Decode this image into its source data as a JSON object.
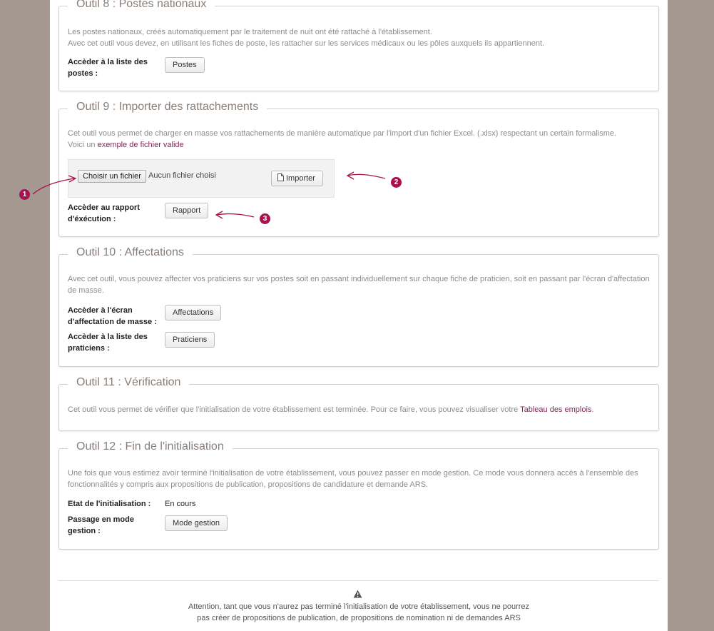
{
  "tool8": {
    "title": "Outil 8 : Postes nationaux",
    "desc1": "Les postes nationaux, créés automatiquement par le traitement de nuit ont été rattaché à l'établissement.",
    "desc2": "Avec cet outil vous devez, en utilisant les fiches de poste, les rattacher sur les services médicaux ou les pôles auxquels ils appartiennent.",
    "label": "Accèder à la liste des postes :",
    "button": "Postes"
  },
  "tool9": {
    "title": "Outil 9 : Importer des rattachements",
    "desc1": "Cet outil vous permet de charger en masse vos rattachements de manière automatique par l'import d'un fichier Excel. (.xlsx) respectant un certain formalisme.",
    "desc2_prefix": "Voici un",
    "desc2_link": "exemple de fichier valide",
    "file_button": "Choisir un fichier",
    "file_status": "Aucun fichier choisi",
    "import_button": "Importer",
    "report_label": "Accèder au rapport d'éxécution :",
    "report_button": "Rapport",
    "badges": [
      "1",
      "2",
      "3"
    ]
  },
  "tool10": {
    "title": "Outil 10 : Affectations",
    "desc": "Avec cet outil, vous pouvez affecter vos praticiens sur vos postes soit en passant individuellement sur chaque fiche de praticien, soit en passant par l'écran d'affectation de masse.",
    "label1": "Accèder à l'écran d'affectation de masse :",
    "button1": "Affectations",
    "label2": "Accèder à la liste des praticiens :",
    "button2": "Praticiens"
  },
  "tool11": {
    "title": "Outil 11 : Vérification",
    "desc_prefix": "Cet outil vous permet de vérifier que l'initialisation de votre établissement est terminée. Pour ce faire, vous pouvez visualiser votre",
    "desc_link": "Tableau des emplois",
    "desc_suffix": "."
  },
  "tool12": {
    "title": "Outil 12 : Fin de l'initialisation",
    "desc": "Une fois que vous estimez avoir terminé l'initialisation de votre établissement, vous pouvez passer en mode gestion. Ce mode vous donnera accès à l'ensemble des fonctionnalités y compris aux propositions de publication, propositions de candidature et demande ARS.",
    "status_label": "Etat de l'initialisation :",
    "status_value": "En cours",
    "mode_label": "Passage en mode gestion :",
    "mode_button": "Mode gestion"
  },
  "footer": {
    "warning_line1": "Attention, tant que vous n'aurez pas terminé l'initialisation de votre établissement, vous ne pourrez",
    "warning_line2": "pas créer de propositions de publication, de propositions de nomination ni de demandes ARS"
  },
  "colors": {
    "background": "#a59891",
    "link": "#7b2a57",
    "annotation": "#a8134f"
  }
}
